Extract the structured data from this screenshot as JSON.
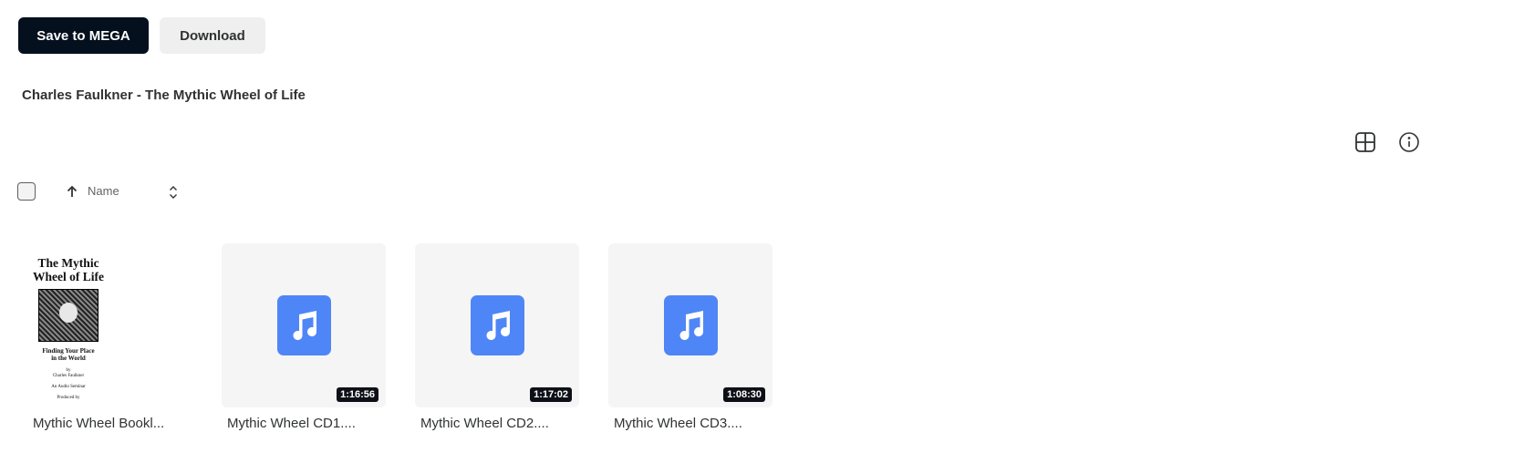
{
  "toolbar": {
    "save_label": "Save to MEGA",
    "download_label": "Download"
  },
  "folder": {
    "title": "Charles Faulkner - The Mythic Wheel of Life"
  },
  "view_icons": [
    "grid-view-icon",
    "info-icon"
  ],
  "sort": {
    "label": "Name",
    "direction": "ascending"
  },
  "booklet_cover": {
    "title_line1": "The Mythic",
    "title_line2": "Wheel of Life",
    "subtitle_line1": "Finding Your Place",
    "subtitle_line2": "in the World",
    "by": "by",
    "author": "Charles Faulkner",
    "format": "An Audio Seminar",
    "produced": "Produced by"
  },
  "files": [
    {
      "name": "Mythic Wheel Bookl...",
      "type": "image"
    },
    {
      "name": "Mythic Wheel CD1....",
      "type": "audio",
      "duration": "1:16:56"
    },
    {
      "name": "Mythic Wheel CD2....",
      "type": "audio",
      "duration": "1:17:02"
    },
    {
      "name": "Mythic Wheel CD3....",
      "type": "audio",
      "duration": "1:08:30"
    }
  ],
  "colors": {
    "primary_button": "#04101e",
    "secondary_button": "#efefef",
    "audio_icon": "#4f86f7",
    "duration_badge": "#0d1117"
  }
}
